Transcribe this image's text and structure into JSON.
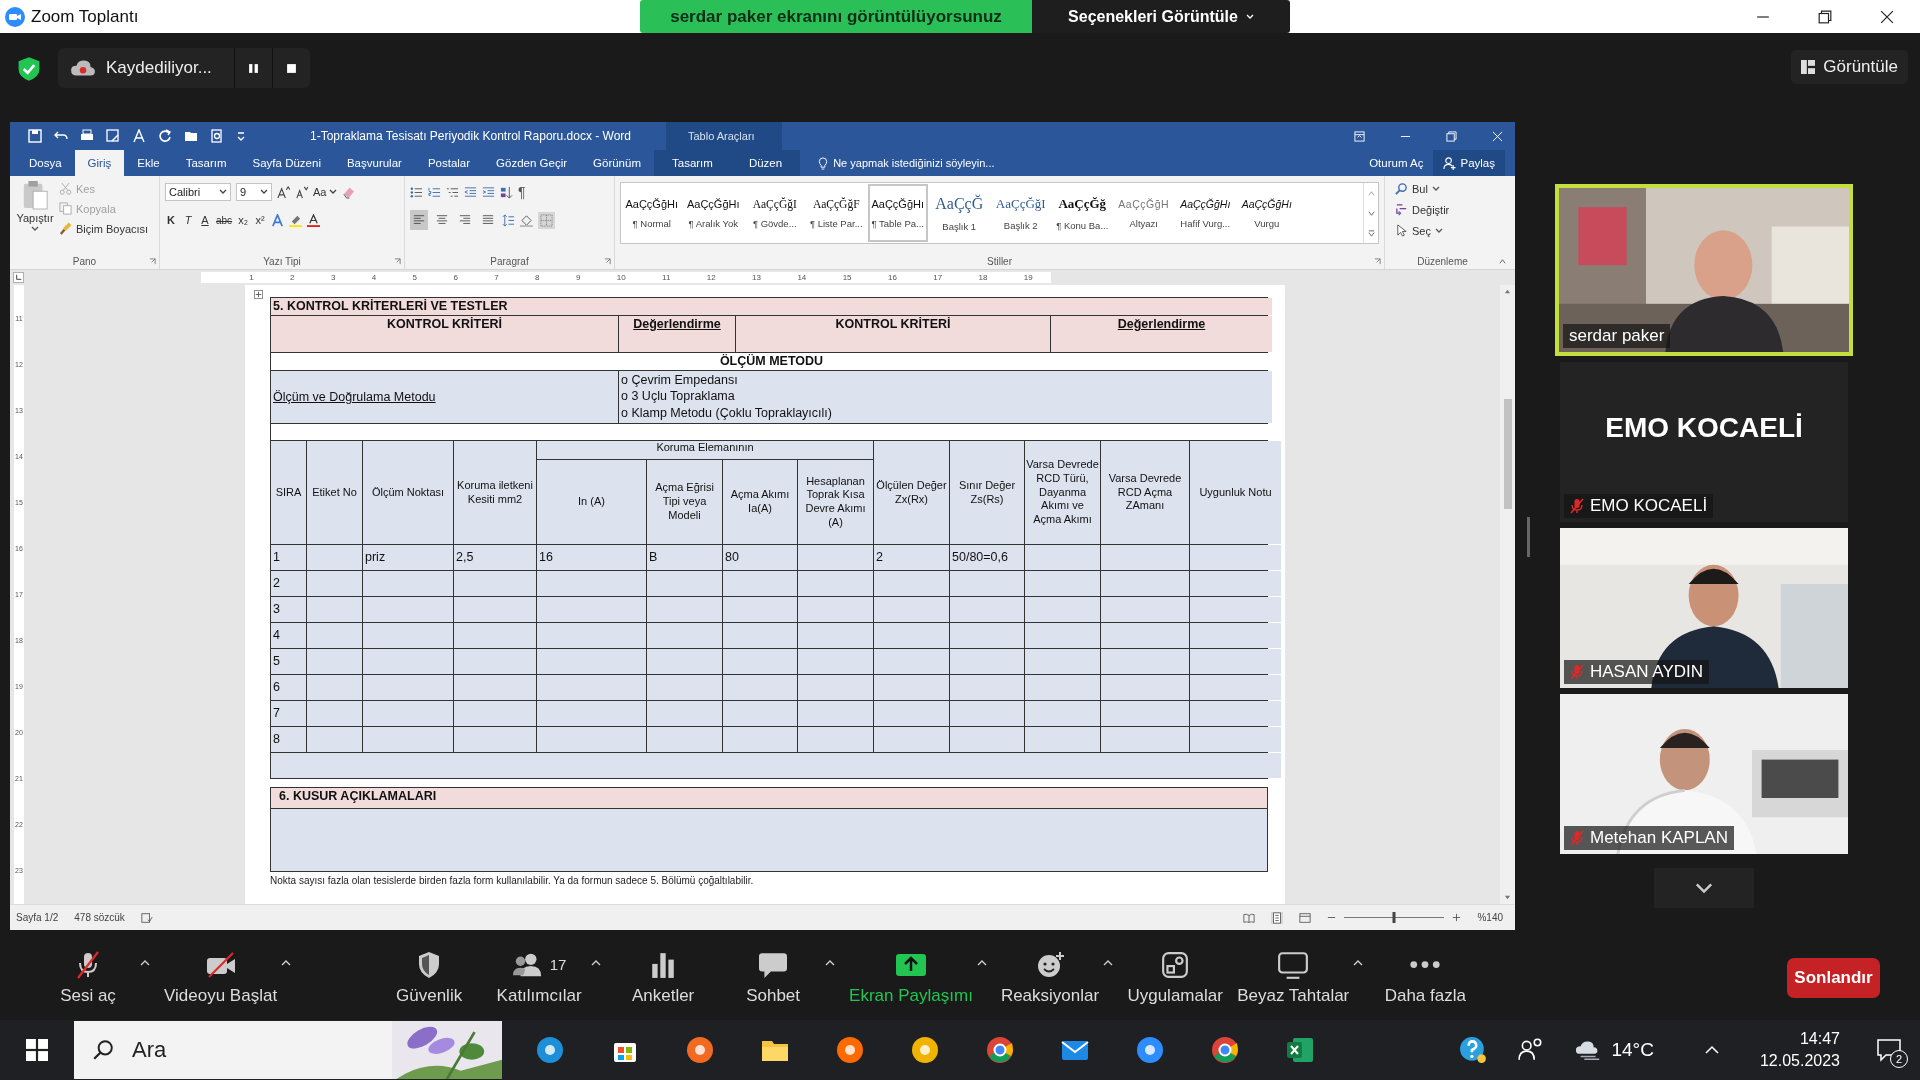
{
  "zoom_window": {
    "title": "Zoom Toplantı"
  },
  "share_banner": {
    "message": "serdar paker ekranını görüntülüyorsunuz",
    "options": "Seçenekleri Görüntüle"
  },
  "recording": {
    "label": "Kaydediliyor..."
  },
  "view_button": "Görüntüle",
  "word": {
    "title": "1-Topraklama Tesisatı Periyodik Kontrol Raporu.docx - Word",
    "context_title": "Tablo Araçları",
    "tabs": [
      {
        "label": "Dosya",
        "selected": false,
        "kind": "main"
      },
      {
        "label": "Giriş",
        "selected": true,
        "kind": "main"
      },
      {
        "label": "Ekle",
        "selected": false,
        "kind": "main"
      },
      {
        "label": "Tasarım",
        "selected": false,
        "kind": "main"
      },
      {
        "label": "Sayfa Düzeni",
        "selected": false,
        "kind": "main"
      },
      {
        "label": "Başvurular",
        "selected": false,
        "kind": "main"
      },
      {
        "label": "Postalar",
        "selected": false,
        "kind": "main"
      },
      {
        "label": "Gözden Geçir",
        "selected": false,
        "kind": "main"
      },
      {
        "label": "Görünüm",
        "selected": false,
        "kind": "main"
      },
      {
        "label": "Tasarım",
        "selected": false,
        "kind": "context"
      },
      {
        "label": "Düzen",
        "selected": false,
        "kind": "context"
      }
    ],
    "tell_me": "Ne yapmak istediğinizi söyleyin...",
    "sign_in": "Oturum Aç",
    "share": "Paylaş",
    "clipboard": {
      "label": "Pano",
      "paste": "Yapıştır",
      "actions": [
        {
          "label": "Kes",
          "kind": "cut",
          "disabled": true
        },
        {
          "label": "Kopyala",
          "kind": "copy",
          "disabled": true
        },
        {
          "label": "Biçim Boyacısı",
          "kind": "painter",
          "disabled": false
        }
      ]
    },
    "font": {
      "label": "Yazı Tipi",
      "family": "Calibri",
      "size": "9",
      "change_case": "Aa",
      "format_buttons": [
        {
          "label": "K",
          "kind": "bold"
        },
        {
          "label": "T",
          "kind": "italic"
        },
        {
          "label": "A",
          "kind": "underline"
        },
        {
          "label": "abc",
          "kind": "strike"
        },
        {
          "label": "x₂",
          "kind": "plain"
        },
        {
          "label": "x²",
          "kind": "plain"
        }
      ]
    },
    "paragraph": {
      "label": "Paragraf",
      "marks": "¶",
      "align_buttons": [
        {
          "kind": "left",
          "selected": true
        },
        {
          "kind": "center",
          "selected": false
        },
        {
          "kind": "right",
          "selected": false
        },
        {
          "kind": "justify",
          "selected": false
        }
      ]
    },
    "styles": {
      "label": "Stiller",
      "items": [
        {
          "sample": "AaÇçĞğHı",
          "name": "¶ Normal",
          "kind": "body",
          "selected": false
        },
        {
          "sample": "AaÇçĞğHı",
          "name": "¶ Aralık Yok",
          "kind": "body",
          "selected": false
        },
        {
          "sample": "AaÇçĞğI",
          "name": "¶ Gövde...",
          "kind": "serif",
          "selected": false
        },
        {
          "sample": "AaÇçĞğF",
          "name": "¶ Liste Par...",
          "kind": "serif",
          "selected": false
        },
        {
          "sample": "AaÇçĞğHı",
          "name": "¶ Table Pa...",
          "kind": "body",
          "selected": true
        },
        {
          "sample": "AaÇçĞ",
          "name": "Başlık 1",
          "kind": "heading",
          "selected": false
        },
        {
          "sample": "AaÇçĞğI",
          "name": "Başlık 2",
          "kind": "heading2",
          "selected": false
        },
        {
          "sample": "AaÇçĞğ",
          "name": "¶ Konu Ba...",
          "kind": "title",
          "selected": false
        },
        {
          "sample": "AaÇçĞğH",
          "name": "Altyazı",
          "kind": "subtle",
          "selected": false
        },
        {
          "sample": "AaÇçĞğHı",
          "name": "Hafif Vurg...",
          "kind": "emphasis",
          "selected": false
        },
        {
          "sample": "AaÇçĞğHı",
          "name": "Vurgu",
          "kind": "emphasis",
          "selected": false
        }
      ]
    },
    "editing": {
      "label": "Düzenleme",
      "find": "Bul",
      "replace": "Değiştir",
      "select": "Seç"
    },
    "ruler": [
      "1",
      "2",
      "3",
      "4",
      "5",
      "6",
      "7",
      "8",
      "9",
      "10",
      "11",
      "12",
      "13",
      "14",
      "15",
      "16",
      "17",
      "18",
      "19"
    ],
    "vertical_ruler": [
      "11",
      "12",
      "13",
      "14",
      "15",
      "16",
      "17",
      "18",
      "19",
      "20",
      "21",
      "22",
      "23"
    ],
    "document": {
      "section5": {
        "title": "5. KONTROL KRİTERLERİ VE TESTLER",
        "criteria_header": [
          "KONTROL KRİTERİ",
          "Değerlendirme",
          "KONTROL KRİTERİ",
          "Değerlendirme"
        ]
      },
      "method": {
        "title": "ÖLÇÜM METODU",
        "label": "Ölçüm ve Doğrulama Metodu",
        "options": [
          "o Çevrim Empedansı",
          "o 3 Uçlu Topraklama",
          "o  Klamp Metodu (Çoklu Topraklayıcılı)"
        ]
      },
      "measurements": {
        "group_header": "Koruma Elemanının",
        "columns": [
          {
            "label": "SIRA",
            "grouped": false
          },
          {
            "label": "Etiket No",
            "grouped": false
          },
          {
            "label": "Ölçüm Noktası",
            "grouped": false
          },
          {
            "label": "Koruma iletkeni Kesiti mm2",
            "grouped": false
          },
          {
            "label": "In (A)",
            "grouped": true
          },
          {
            "label": "Açma Eğrisi Tipi veya Modeli",
            "grouped": true
          },
          {
            "label": "Açma Akımı Ia(A)",
            "grouped": true
          },
          {
            "label": "Hesaplanan Toprak Kısa Devre Akımı (A)",
            "grouped": true
          },
          {
            "label": "Ölçülen Değer Zx(Rx)",
            "grouped": false
          },
          {
            "label": "Sınır Değer Zs(Rs)",
            "grouped": false
          },
          {
            "label": "Varsa Devrede RCD Türü, Dayanma Akımı ve Açma Akımı",
            "grouped": false
          },
          {
            "label": "Varsa Devrede RCD Açma ZAmanı",
            "grouped": false
          },
          {
            "label": "Uygunluk Notu",
            "grouped": false
          }
        ],
        "rows": [
          [
            "1",
            null,
            "priz",
            "2,5",
            "16",
            "B",
            "80",
            null,
            "2",
            "50/80=0,6",
            null,
            null,
            null
          ],
          [
            "2",
            null,
            null,
            null,
            null,
            null,
            null,
            null,
            null,
            null,
            null,
            null,
            null
          ],
          [
            "3",
            null,
            null,
            null,
            null,
            null,
            null,
            null,
            null,
            null,
            null,
            null,
            null
          ],
          [
            "4",
            null,
            null,
            null,
            null,
            null,
            null,
            null,
            null,
            null,
            null,
            null,
            null
          ],
          [
            "5",
            null,
            null,
            null,
            null,
            null,
            null,
            null,
            null,
            null,
            null,
            null,
            null
          ],
          [
            "6",
            null,
            null,
            null,
            null,
            null,
            null,
            null,
            null,
            null,
            null,
            null,
            null
          ],
          [
            "7",
            null,
            null,
            null,
            null,
            null,
            null,
            null,
            null,
            null,
            null,
            null,
            null
          ],
          [
            "8",
            null,
            null,
            null,
            null,
            null,
            null,
            null,
            null,
            null,
            null,
            null,
            null
          ]
        ]
      },
      "section6": {
        "title": "6. KUSUR AÇIKLAMALARI"
      },
      "note": "Nokta sayısı fazla olan tesislerde birden fazla form kullanılabilir. Ya da formun sadece 5. Bölümü çoğaltılabilir."
    },
    "status_bar": {
      "page": "Sayfa 1/2",
      "words": "478 sözcük",
      "zoom": "%140",
      "level": 0.5
    }
  },
  "participants": [
    {
      "name": "serdar paker",
      "video": true,
      "speaking": true,
      "muted": false
    },
    {
      "name": "EMO KOCAELİ",
      "card_text": "EMO KOCAELİ",
      "video": false,
      "speaking": false,
      "muted": true
    },
    {
      "name": "HASAN AYDIN",
      "video": true,
      "speaking": false,
      "muted": true
    },
    {
      "name": "Metehan KAPLAN",
      "video": true,
      "speaking": false,
      "muted": true
    }
  ],
  "toolbar": [
    {
      "label": "Sesi aç",
      "kind": "mic",
      "caret": true
    },
    {
      "label": "Videoyu Başlat",
      "kind": "video",
      "caret": true
    },
    {
      "label": "Güvenlik",
      "kind": "shield",
      "caret": false
    },
    {
      "label": "Katılımcılar",
      "kind": "people",
      "caret": true,
      "count": "17"
    },
    {
      "label": "Anketler",
      "kind": "polls",
      "caret": false
    },
    {
      "label": "Sohbet",
      "kind": "chat",
      "caret": true
    },
    {
      "label": "Ekran Paylaşımı",
      "kind": "share",
      "caret": true
    },
    {
      "label": "Reaksiyonlar",
      "kind": "emoji",
      "caret": true
    },
    {
      "label": "Uygulamalar",
      "kind": "apps",
      "caret": false
    },
    {
      "label": "Beyaz Tahtalar",
      "kind": "board",
      "caret": true
    },
    {
      "label": "Daha fazla",
      "kind": "more",
      "caret": false
    }
  ],
  "end_button": "Sonlandır",
  "taskbar": {
    "search": "Ara",
    "weather": "14°C",
    "time": "14:47",
    "date": "12.05.2023",
    "notifications": "2"
  }
}
